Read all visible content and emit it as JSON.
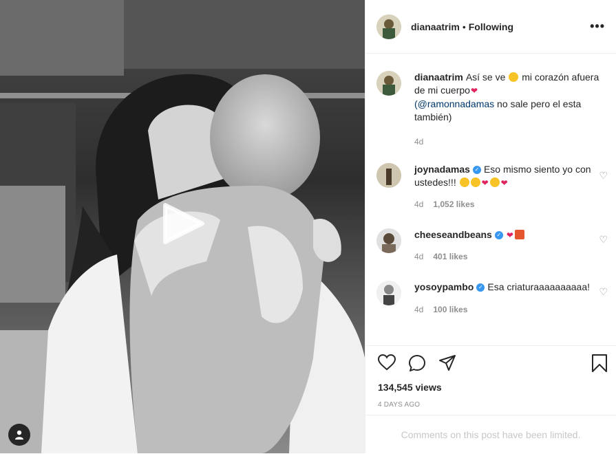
{
  "post": {
    "username": "dianaatrim",
    "separator": "•",
    "follow_status": "Following",
    "more_label": "•••"
  },
  "caption": {
    "username": "dianaatrim",
    "text_1": "Así se ve",
    "text_2": "mi corazón afuera de mi cuerpo",
    "mention": "(@ramonnadamas",
    "text_3": "no sale pero el esta también)",
    "time": "4d"
  },
  "comments": [
    {
      "username": "joynadamas",
      "text": "Eso mismo siento yo con ustedes!!!",
      "time": "4d",
      "likes": "1,052 likes",
      "verified": true
    },
    {
      "username": "cheeseandbeans",
      "text": "",
      "time": "4d",
      "likes": "401 likes",
      "verified": true
    },
    {
      "username": "yosoypambo",
      "text": "Esa criaturaaaaaaaaaa!",
      "time": "4d",
      "likes": "100 likes",
      "verified": true
    }
  ],
  "stats": {
    "views": "134,545 views",
    "date": "4 DAYS AGO"
  },
  "limited_text": "Comments on this post have been limited.",
  "icons": {
    "like": "heart-icon",
    "comment": "comment-icon",
    "share": "share-icon",
    "save": "bookmark-icon",
    "play": "play-icon",
    "tagged": "user-icon"
  }
}
